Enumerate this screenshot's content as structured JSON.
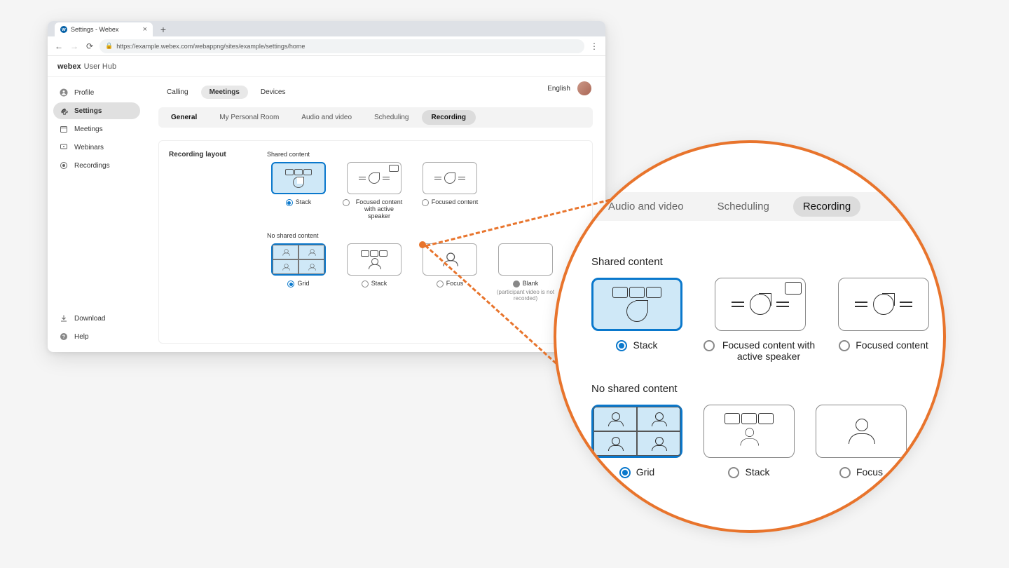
{
  "browser": {
    "tab_title": "Settings - Webex",
    "url": "https://example.webex.com/webappng/sites/example/settings/home"
  },
  "header": {
    "brand": "webex",
    "subtitle": "User Hub"
  },
  "topbar": {
    "language": "English"
  },
  "sidebar": {
    "items": [
      {
        "label": "Profile"
      },
      {
        "label": "Settings"
      },
      {
        "label": "Meetings"
      },
      {
        "label": "Webinars"
      },
      {
        "label": "Recordings"
      }
    ],
    "bottom": [
      {
        "label": "Download"
      },
      {
        "label": "Help"
      }
    ]
  },
  "main_tabs": {
    "items": [
      {
        "label": "Calling"
      },
      {
        "label": "Meetings"
      },
      {
        "label": "Devices"
      }
    ]
  },
  "sub_tabs": {
    "items": [
      {
        "label": "General"
      },
      {
        "label": "My Personal Room"
      },
      {
        "label": "Audio and video"
      },
      {
        "label": "Scheduling"
      },
      {
        "label": "Recording"
      }
    ]
  },
  "panel": {
    "title": "Recording layout",
    "shared_title": "Shared content",
    "shared_options": [
      {
        "label": "Stack"
      },
      {
        "label": "Focused content with active speaker"
      },
      {
        "label": "Focused content"
      }
    ],
    "noshared_title": "No shared content",
    "noshared_options": [
      {
        "label": "Grid"
      },
      {
        "label": "Stack"
      },
      {
        "label": "Focus"
      },
      {
        "label": "Blank"
      }
    ],
    "blank_note": "(participant video is not recorded)"
  },
  "zoom": {
    "sub_tabs": [
      {
        "label": "Audio and video"
      },
      {
        "label": "Scheduling"
      },
      {
        "label": "Recording"
      }
    ],
    "shared_title": "Shared content",
    "shared_options": [
      {
        "label": "Stack"
      },
      {
        "label": "Focused content with active speaker"
      },
      {
        "label": "Focused content"
      }
    ],
    "noshared_title": "No shared content",
    "noshared_options": [
      {
        "label": "Grid"
      },
      {
        "label": "Stack"
      },
      {
        "label": "Focus"
      }
    ]
  }
}
